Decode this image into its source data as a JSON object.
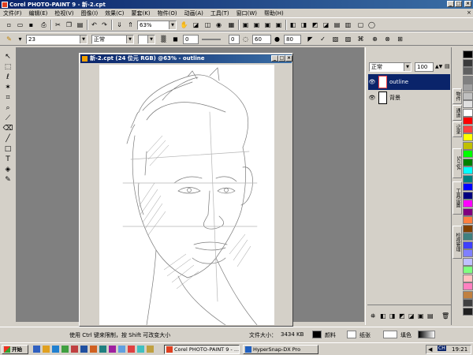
{
  "window": {
    "title": "Corel PHOTO-PAINT 9 - 新-2.cpt"
  },
  "menu": [
    "文件(F)",
    "编辑(E)",
    "检视(V)",
    "图像(I)",
    "效果(C)",
    "蒙套(K)",
    "物件(O)",
    "动画(A)",
    "工具(T)",
    "窗口(W)",
    "帮助(H)"
  ],
  "toolbar": {
    "zoom_value": "63%",
    "brush_size": "23",
    "merge_mode": "正常",
    "transparency": "0",
    "soft_edge": "60",
    "density": "80",
    "rotate": "0"
  },
  "document": {
    "title": "新-2.cpt (24 位元 RGB) @63% - outline"
  },
  "layers_panel": {
    "merge_mode": "正常",
    "opacity": "100",
    "layers": [
      {
        "name": "outline",
        "selected": true
      },
      {
        "name": "背景",
        "selected": false
      }
    ]
  },
  "docker_tabs": [
    "物件",
    "通道",
    "记录",
    "Script",
    "工具设置",
    "检视管理"
  ],
  "status": {
    "hint": "使用 Ctrl 键来限制，按 Shift 可改变大小",
    "doc_size_label": "文件大小：",
    "doc_size_value": "3434 KB",
    "color_label": "颜料",
    "paper_label": "纸张",
    "fill_label": "填色"
  },
  "taskbar": {
    "start_label": "开始",
    "apps": [
      "Corel PHOTO-PAINT 9 - ...",
      "HyperSnap-DX Pro"
    ],
    "clock": "19:21",
    "ime": "CH"
  },
  "colors": {
    "title_start": "#0a246a",
    "title_end": "#3a6ea5",
    "face": "#d4d0c8",
    "workspace": "#808080",
    "selected_layer": "#0a246a"
  },
  "palette_colors": [
    "#000000",
    "#3a3a3a",
    "#606060",
    "#808080",
    "#a0a0a0",
    "#c0c0c0",
    "#e0e0e0",
    "#ffffff",
    "#ff0000",
    "#ff4040",
    "#ffff00",
    "#c0c000",
    "#00ff00",
    "#008000",
    "#00ffff",
    "#008080",
    "#0000ff",
    "#000080",
    "#ff00ff",
    "#800080",
    "#ff8040",
    "#804000",
    "#408080",
    "#4040ff",
    "#8080ff",
    "#c0c0ff",
    "#80ff80",
    "#ffc0c0",
    "#ff80c0",
    "#c08040",
    "#404040",
    "#202020"
  ]
}
